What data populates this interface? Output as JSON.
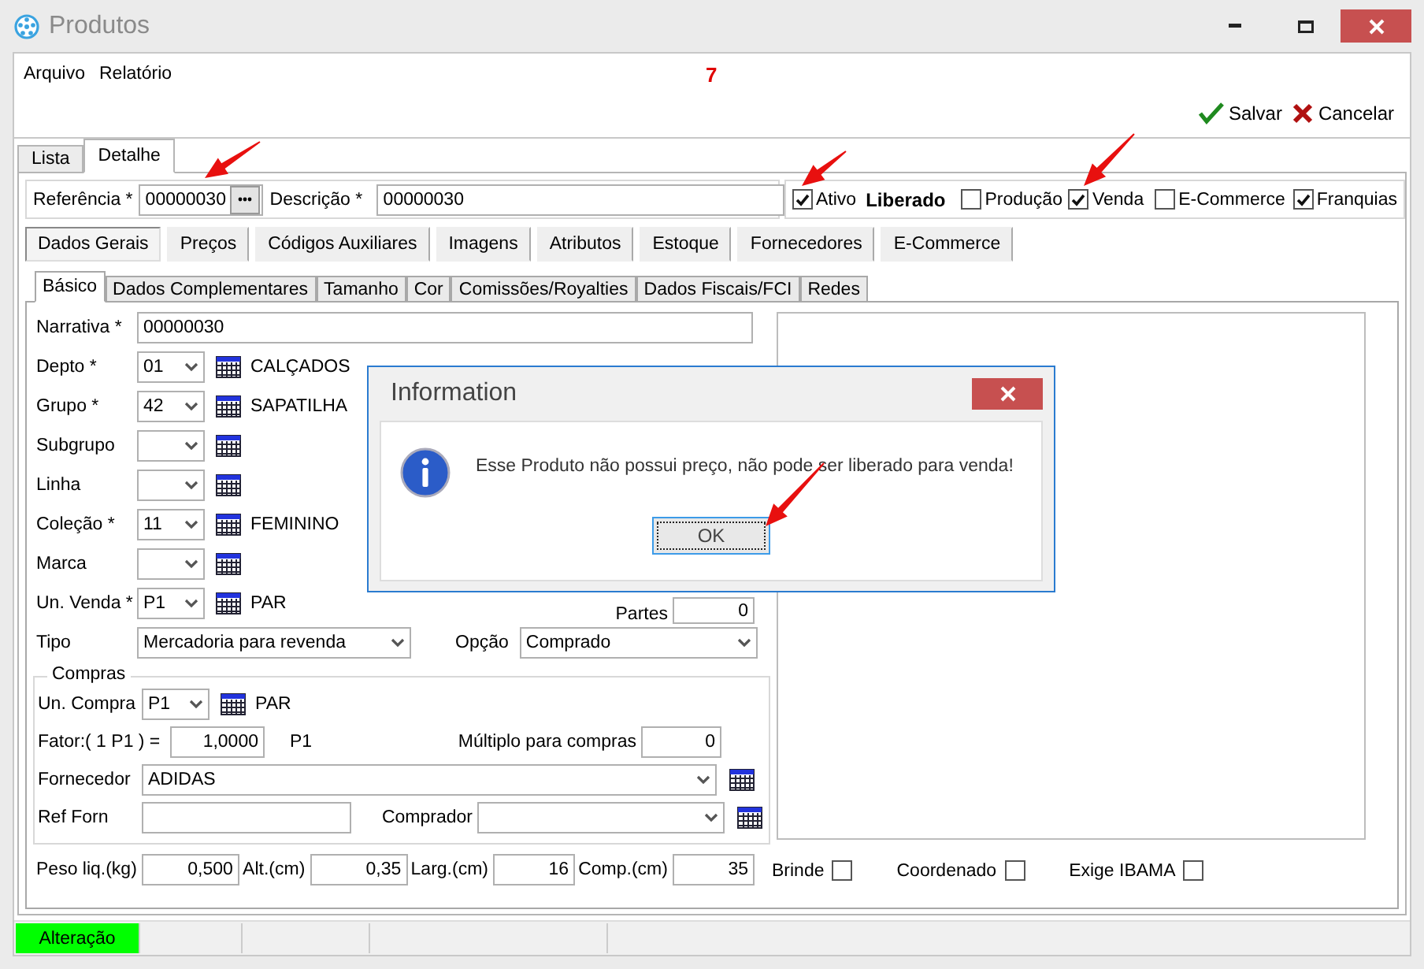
{
  "window": {
    "title": "Produtos"
  },
  "menu": [
    "Arquivo",
    "Relatório"
  ],
  "record_counter": "7",
  "actions": [
    {
      "kind": "save",
      "label": "Salvar"
    },
    {
      "kind": "cancel",
      "label": "Cancelar"
    }
  ],
  "main_tabs": [
    {
      "label": "Lista",
      "selected": false
    },
    {
      "label": "Detalhe",
      "selected": true
    }
  ],
  "header": {
    "reference": {
      "label": "Referência *",
      "value": "00000030"
    },
    "description": {
      "label": "Descrição *",
      "value": "00000030"
    },
    "flags": [
      {
        "kind": "checkbox",
        "label": "Ativo",
        "checked": true
      },
      {
        "kind": "status",
        "label": "Liberado"
      },
      {
        "kind": "checkbox",
        "label": "Produção",
        "checked": false
      },
      {
        "kind": "checkbox",
        "label": "Venda",
        "checked": true
      },
      {
        "kind": "checkbox",
        "label": "E-Commerce",
        "checked": false
      },
      {
        "kind": "checkbox",
        "label": "Franquias",
        "checked": true
      }
    ]
  },
  "section_tabs": [
    {
      "label": "Dados Gerais",
      "selected": true
    },
    {
      "label": "Preços",
      "selected": false
    },
    {
      "label": "Códigos Auxiliares",
      "selected": false
    },
    {
      "label": "Imagens",
      "selected": false
    },
    {
      "label": "Atributos",
      "selected": false
    },
    {
      "label": "Estoque",
      "selected": false
    },
    {
      "label": "Fornecedores",
      "selected": false
    },
    {
      "label": "E-Commerce",
      "selected": false
    }
  ],
  "sub_tabs": [
    {
      "label": "Básico",
      "selected": true
    },
    {
      "label": "Dados Complementares",
      "selected": false
    },
    {
      "label": "Tamanho",
      "selected": false
    },
    {
      "label": "Cor",
      "selected": false
    },
    {
      "label": "Comissões/Royalties",
      "selected": false
    },
    {
      "label": "Dados Fiscais/FCI",
      "selected": false
    },
    {
      "label": "Redes",
      "selected": false
    }
  ],
  "form": {
    "rows": [
      {
        "kind": "text",
        "label": "Narrativa *",
        "value": "00000030"
      },
      {
        "kind": "lookup",
        "label": "Depto *",
        "value": "01",
        "text": "CALÇADOS"
      },
      {
        "kind": "lookup",
        "label": "Grupo *",
        "value": "42",
        "text": "SAPATILHA"
      },
      {
        "kind": "lookup",
        "label": "Subgrupo"
      },
      {
        "kind": "lookup",
        "label": "Linha"
      },
      {
        "kind": "lookup",
        "label": "Coleção *",
        "value": "11",
        "text": "FEMININO"
      },
      {
        "kind": "lookup",
        "label": "Marca"
      },
      {
        "kind": "lookup",
        "label": "Un. Venda *",
        "value": "P1",
        "text": "PAR",
        "extra": {
          "label": "Partes",
          "value": "0"
        }
      },
      {
        "kind": "pair",
        "label": "Tipo",
        "value": "Mercadoria para revenda",
        "extra": {
          "label": "Opção",
          "value": "Comprado"
        }
      }
    ],
    "purchases": {
      "title": "Compras",
      "unit": {
        "label": "Un. Compra",
        "value": "P1",
        "text": "PAR"
      },
      "factor": {
        "label": "Fator:( 1 P1  ) =",
        "value": "1,0000",
        "unit": "P1"
      },
      "multiple": {
        "label": "Múltiplo para compras",
        "value": "0"
      },
      "supplier": {
        "label": "Fornecedor",
        "value": "ADIDAS"
      },
      "supplier_ref": {
        "label": "Ref Forn"
      },
      "buyer": {
        "label": "Comprador"
      }
    },
    "measures": [
      {
        "label": "Peso liq.(kg)",
        "value": "0,500"
      },
      {
        "label": "Alt.(cm)",
        "value": "0,35"
      },
      {
        "label": "Larg.(cm)",
        "value": "16"
      },
      {
        "label": "Comp.(cm)",
        "value": "35"
      }
    ]
  },
  "image_panel": {
    "options": [
      {
        "label": "Brinde",
        "checked": false
      },
      {
        "label": "Coordenado",
        "checked": false
      },
      {
        "label": "Exige IBAMA",
        "checked": false
      }
    ]
  },
  "dialog": {
    "title": "Information",
    "message": "Esse Produto não possui preço, não pode ser liberado para venda!",
    "button": "OK"
  },
  "status_bar": [
    {
      "text": "Alteração",
      "color": "#00ff00"
    }
  ]
}
